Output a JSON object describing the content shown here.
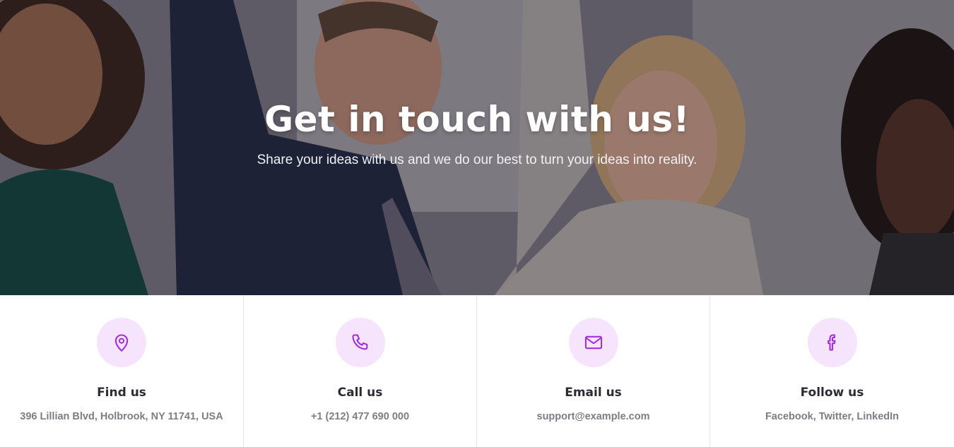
{
  "hero": {
    "title": "Get in touch with us!",
    "subtitle": "Share your ideas with us and we do our best to turn your ideas into reality."
  },
  "contacts": [
    {
      "icon": "location-pin-icon",
      "title": "Find us",
      "text": "396 Lillian Blvd, Holbrook, NY 11741, USA"
    },
    {
      "icon": "phone-icon",
      "title": "Call us",
      "text": "+1 (212) 477 690 000"
    },
    {
      "icon": "envelope-icon",
      "title": "Email us",
      "text": "support@example.com"
    },
    {
      "icon": "facebook-icon",
      "title": "Follow us",
      "text": "Facebook, Twitter, LinkedIn"
    }
  ],
  "colors": {
    "accent": "#a330d6",
    "icon_background": "#f6e4fc",
    "title_text": "#2b2b33",
    "body_text": "#7d7d85"
  }
}
